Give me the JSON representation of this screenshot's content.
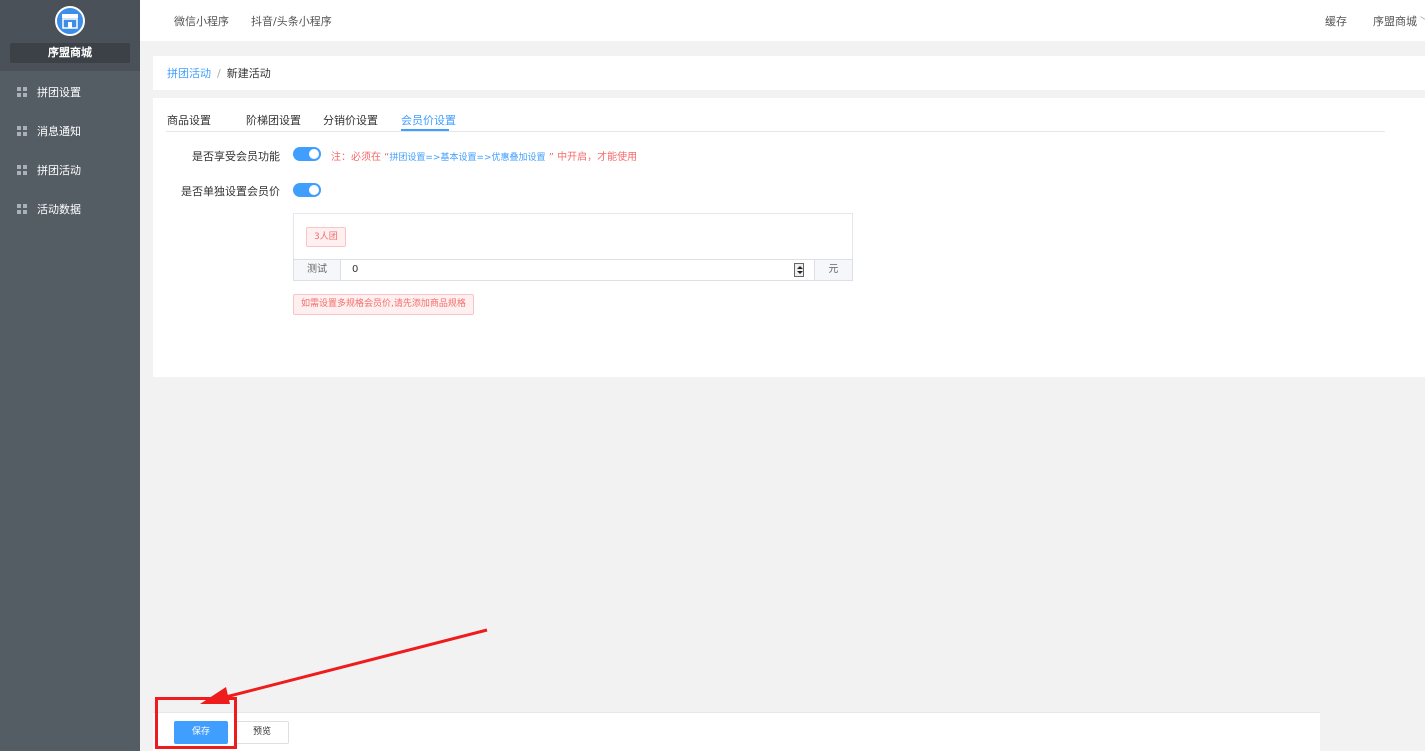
{
  "sidebar": {
    "shop_name": "序盟商城",
    "items": [
      {
        "label": "拼团设置"
      },
      {
        "label": "消息通知"
      },
      {
        "label": "拼团活动"
      },
      {
        "label": "活动数据"
      }
    ]
  },
  "topbar": {
    "links": [
      "微信小程序",
      "抖音/头条小程序"
    ],
    "cache": "缓存",
    "user": "序盟商城"
  },
  "breadcrumb": {
    "parent": "拼团活动",
    "separator": "/",
    "current": "新建活动"
  },
  "tabs": [
    "商品设置",
    "阶梯团设置",
    "分销价设置",
    "会员价设置"
  ],
  "active_tab": "会员价设置",
  "form": {
    "member_enable_label": "是否享受会员功能",
    "member_enable_on": true,
    "note_prefix": "注：必须在 “",
    "note_path": "拼团设置=>基本设置=>优惠叠加设置",
    "note_suffix": " ” 中开启，才能使用",
    "separate_price_label": "是否单独设置会员价",
    "separate_price_on": true,
    "spec_tag": "3人团",
    "price_prefix": "测试",
    "price_value": "0",
    "price_unit": "元",
    "warning": "如需设置多规格会员价,请先添加商品规格"
  },
  "footer": {
    "save": "保存",
    "preview": "预览"
  },
  "colors": {
    "primary": "#409eff",
    "sidebar": "#545c64",
    "danger": "#f56c6c",
    "annotation": "#ee1c1c"
  }
}
